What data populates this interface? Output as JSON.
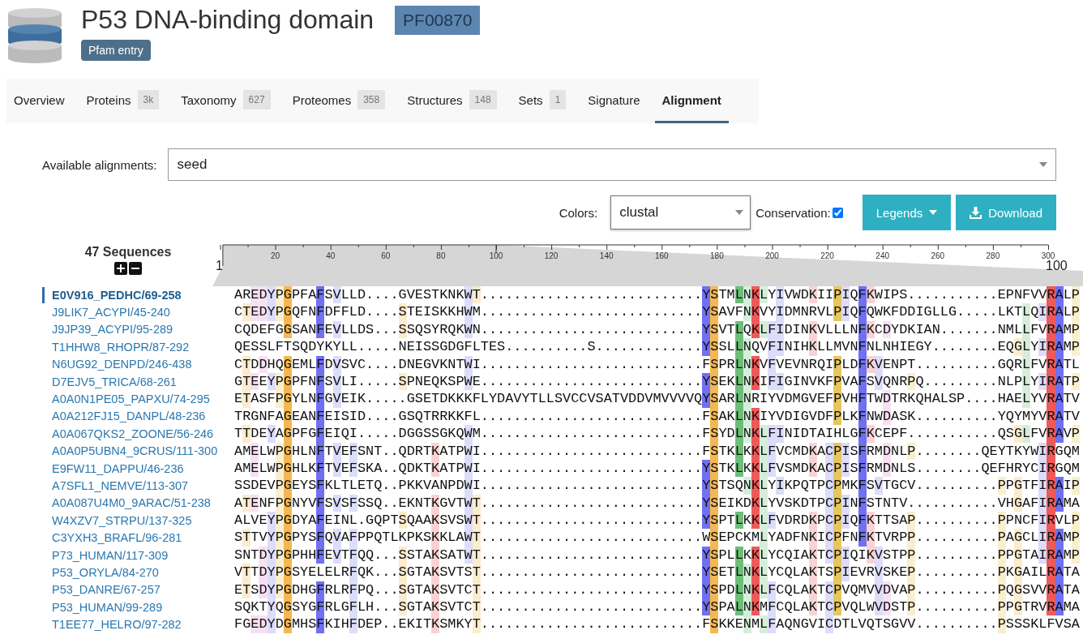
{
  "entry": {
    "title": "P53 DNA-binding domain",
    "accession": "PF00870",
    "type_tag": "Pfam entry"
  },
  "tabs": [
    {
      "label": "Overview",
      "selected": false
    },
    {
      "label": "Proteins",
      "count": "3k",
      "selected": false
    },
    {
      "label": "Taxonomy",
      "count": "627",
      "selected": false
    },
    {
      "label": "Proteomes",
      "count": "358",
      "selected": false
    },
    {
      "label": "Structures",
      "count": "148",
      "selected": false
    },
    {
      "label": "Sets",
      "count": "1",
      "selected": false
    },
    {
      "label": "Signature",
      "selected": false
    },
    {
      "label": "Alignment",
      "selected": true
    }
  ],
  "alignment_select": {
    "label": "Available alignments:",
    "value": "seed"
  },
  "controls": {
    "colors_label": "Colors:",
    "colors_value": "clustal",
    "conservation_label": "Conservation:",
    "conservation": true,
    "legends_button": "Legends",
    "download_button": "Download"
  },
  "sequence_count": "47 Sequences",
  "ruler": {
    "start": "1",
    "end": "100",
    "ticks": [
      "20",
      "40",
      "60",
      "80",
      "100",
      "120",
      "140",
      "160",
      "180",
      "200",
      "220",
      "240",
      "260",
      "280",
      "300"
    ]
  },
  "sequences": [
    {
      "name": "E0V916_PEDHC/69-258",
      "selected": true,
      "residues": "AREDYPGPFAFSVLLD....GVESTKNKWT...........................YSTMLNKLYIVWDKIIPIQFKWIPS...........EPNFVVRALP"
    },
    {
      "name": "J9LIK7_ACYPI/45-240",
      "selected": false,
      "residues": "CTEDYPGQFNFDFFLD....STEISKKHWM...........................YSAVFNKVYIDMNRVLPIQFQWKFDDIGLLG.....LKTLQIRALP"
    },
    {
      "name": "J9JP39_ACYPI/95-289",
      "selected": false,
      "residues": "CQDEFGGSANFEVLLDS...SSQSYRQKWN...........................YSVTLQKLFIDINKVLLLNFKCDYDKIAN.......NMLLFVRAMP"
    },
    {
      "name": "T1HHW8_RHOPR/87-292",
      "selected": false,
      "residues": "QESSLFTSQDYKYLL.....NEISSGDGFLTES..........S.............YSSLLNQVFINIHKLLMVNFNLNHIEGY........EQGLYIRAMP"
    },
    {
      "name": "N6UG92_DENPD/246-438",
      "selected": false,
      "residues": "CTDDHQGEMLFDVSVC....DNEGVKNTWI...........................FSPRLNKVFVEVNRQIPLDFKVENPT..........GQRLFVRATL"
    },
    {
      "name": "D7EJV5_TRICA/68-261",
      "selected": false,
      "residues": "GTEEYPGPFNFSVLI.....SPNEQKSPWE...........................YSEKLNKIFIGINVKFPVAFSVQNRPQ.........NLPLYIRATP"
    },
    {
      "name": "A0A0N1PE05_PAPXU/74-295",
      "selected": false,
      "residues": "ETASFPGYLNFGVEIK.....GSETDKKKFLYDAVYTLLSVCCVSATVDDVMVVVVQYSARLNRIYVDMGVEFPVHFTWDTRKQHALSP....HAELYVRATV"
    },
    {
      "name": "A0A212FJ15_DANPL/48-236",
      "selected": false,
      "residues": "TRGNFAGEANFEISID....GSQTRRKKFL...........................FSAKLNKIYVDIGVDFPLKFNWDASK..........YQYMYVRATV"
    },
    {
      "name": "A0A067QKS2_ZOONE/56-246",
      "selected": false,
      "residues": "TTDEYAGPFGFEIQI.....DGGSSGKQWM...........................FSYDLNKLFINIDTAIHLGFKCEPF...........QSGLFVRAVP"
    },
    {
      "name": "A0A0P5UBN4_9CRUS/111-300",
      "selected": false,
      "residues": "AMELWPGHLNFTVEFSNT..QDRTKATPWI...........................FSTKLKKLFVCMDKACPISFRMDNLP........QEYTKYWIRGQM"
    },
    {
      "name": "E9FW11_DAPPU/46-236",
      "selected": false,
      "residues": "AMELWPGHLKFTVEFSKA..QDKTKATPWI...........................YSTKLKKLFVSMDKACPISFRMDNLS........QEFHRYCIRGQM"
    },
    {
      "name": "A7SFL1_NEMVE/113-307",
      "selected": false,
      "residues": "SSDEVPGEYSFKLTLETQ..PKKVANPDWI...........................YSTSQNKLYIKPQTPCPMKFSVTGCV..........PPGTFIRAIP"
    },
    {
      "name": "A0A087U4M0_9ARAC/51-238",
      "selected": false,
      "residues": "ATENFPGNYVFSVSFSSQ..EKNTKGVTWT...........................YSEIKDKLYVSKDTPCPINFSTNTV...........VHGAFIRAMA"
    },
    {
      "name": "W4XZV7_STRPU/137-325",
      "selected": false,
      "residues": "ALVEYPGDYAFEINL.GQPTSQAAKSVSWT...........................YSPTLKKLFVDRDKPCPIQFKTTSAP..........PPNCFIRVLP"
    },
    {
      "name": "C3YXH3_BRAFL/96-281",
      "selected": false,
      "residues": "STTVYPGPYSFQVAFPPQTLKPKSKKLAWT...........................WSEPCKMLYADFNKICPFNFKTVRPP..........PAGCLIRAMP"
    },
    {
      "name": "P73_HUMAN/117-309",
      "selected": false,
      "residues": "SNTDYPGPHHFEVTFQQ...SSTAKSATWT...........................YSPLLKKLYCQIAKTCPIQIKVSTPP..........PPGTAIRAMP"
    },
    {
      "name": "P53_ORYLA/84-270",
      "selected": false,
      "residues": "VTTDYPGSYELELRFQK...SGTAKSVTST...........................YSETLNKLYCQLAKTSPIEVRVSKEP..........PKGAILRATA"
    },
    {
      "name": "P53_DANRE/67-257",
      "selected": false,
      "residues": "ETSDYPGDHGFRLRFPQ...SGTAKSVTCT...........................YSPDLNKLFCQLAKTCPVQMVVDVAP..........PQGSVVRATA"
    },
    {
      "name": "P53_HUMAN/99-289",
      "selected": false,
      "residues": "SQKTYQGSYGFRLGFLH...SGTAKSVTCT...........................YSPALNKMFCQLAKTCPVQLWVDSTP..........PPGTRVRAMA"
    },
    {
      "name": "T1EE77_HELRO/97-282",
      "selected": false,
      "residues": "FGEDYDGMHSFKIHFDEP..EKITKSMKYT...........................FSKKENMLFAQNGVICDTLVQTSGVV..........PSSSKLFVSA"
    }
  ]
}
